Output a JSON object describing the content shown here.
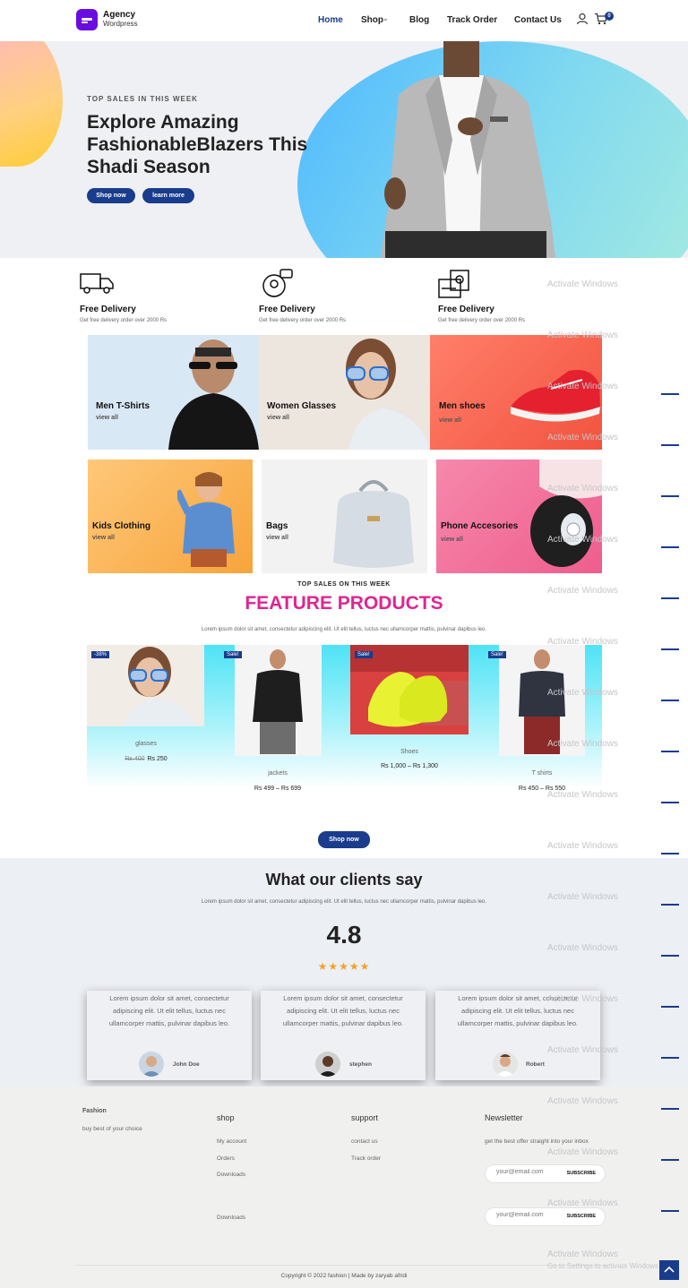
{
  "nav": {
    "logo_title": "Agency",
    "logo_subtitle": "Wordpress",
    "items": [
      {
        "label": "Home",
        "active": true
      },
      {
        "label": "Shop",
        "active": false
      },
      {
        "label": "Blog",
        "active": false
      },
      {
        "label": "Track Order",
        "active": false
      },
      {
        "label": "Contact Us",
        "active": false
      }
    ],
    "cart_count": "0",
    "icons": [
      "user-icon",
      "cart-icon",
      "chevron-down-icon"
    ]
  },
  "hero": {
    "kicker": "TOP SALES IN THIS WEEK",
    "title": "Explore Amazing FashionableBlazers This Shadi Season",
    "btn_shop": "Shop now",
    "btn_learn": "learn more"
  },
  "features": [
    {
      "title": "Free Delivery",
      "text": "Get free delivery order over 2000 Rs",
      "icon": "truck-icon"
    },
    {
      "title": "Free Delivery",
      "text": "Get free delivery order over 2000 Rs",
      "icon": "support-icon"
    },
    {
      "title": "Free Delivery",
      "text": "Get free delivery order over 2000 Rs",
      "icon": "payment-icon"
    }
  ],
  "categories": [
    {
      "title": "Men T-Shirts",
      "link": "view all"
    },
    {
      "title": "Women Glasses",
      "link": "view all"
    },
    {
      "title": "Men shoes",
      "link": "view all"
    },
    {
      "title": "Kids Clothing",
      "link": "view all"
    },
    {
      "title": "Bags",
      "link": "view all"
    },
    {
      "title": "Phone Accesories",
      "link": "view all"
    }
  ],
  "products_section": {
    "kicker": "TOP SALES ON THIS WEEK",
    "title": "FEATURE PRODUCTS",
    "text": "Lorem ipsum dolor sit amet, consectetur adipiscing elit. Ut elit tellus, luctus nec ullamcorper mattis, pulvinar dapibus leo.",
    "products": [
      {
        "badge": "-38%",
        "name": "glasses",
        "old_price": "Rs 400",
        "price": "Rs 250"
      },
      {
        "badge": "Sale!",
        "name": "jackets",
        "old_price": "",
        "price": "Rs 499 – Rs 699"
      },
      {
        "badge": "Sale!",
        "name": "Shoes",
        "old_price": "",
        "price": "Rs 1,000 – Rs 1,300"
      },
      {
        "badge": "Sale!",
        "name": "T shirts",
        "old_price": "",
        "price": "Rs 450 – Rs 550"
      }
    ],
    "btn": "Shop now"
  },
  "testimonials": {
    "title": "What our clients say",
    "text": "Lorem ipsum dolor sit amet, consectetur adipiscing elit. Ut elit tellus, luctus nec ullamcorper mattis, pulvinar dapibus leo.",
    "rating": "4.8",
    "stars": "★★★★★",
    "cards": [
      {
        "text": "Lorem ipsum dolor sit amet, consectetur adipiscing elit. Ut elit tellus, luctus nec ullamcorper mattis, pulvinar dapibus leo.",
        "name": "John Doe"
      },
      {
        "text": "Lorem ipsum dolor sit amet, consectetur adipiscing elit. Ut elit tellus, luctus nec ullamcorper mattis, pulvinar dapibus leo.",
        "name": "stephen"
      },
      {
        "text": "Lorem ipsum dolor sit amet, consectetur adipiscing elit. Ut elit tellus, luctus nec ullamcorper mattis, pulvinar dapibus leo.",
        "name": "Robert"
      }
    ]
  },
  "footer": {
    "brand": "Fashion",
    "brand_text": "buy best of your choice",
    "shop_head": "shop",
    "shop_links": [
      "My account",
      "Orders",
      "Downloads"
    ],
    "support_head": "support",
    "support_links": [
      "contact us",
      "Track order"
    ],
    "news_head": "Newsletter",
    "news_text": "get the best offer straight into your inbox",
    "email_placeholder": "your@email.com",
    "subscribe": "SUBSCRIBE",
    "extra_link": "Downloads",
    "copyright": "Copyright © 2022 fashion | Made by zaryab afridi"
  },
  "overlay": {
    "watermark": "Activate Windows",
    "watermark_sub": "Go to Settings to activate Windows."
  },
  "colors": {
    "primary": "#1a3c8c",
    "accent": "#e0258f",
    "logo": "#6a0ddf",
    "star": "#f4a12b"
  }
}
